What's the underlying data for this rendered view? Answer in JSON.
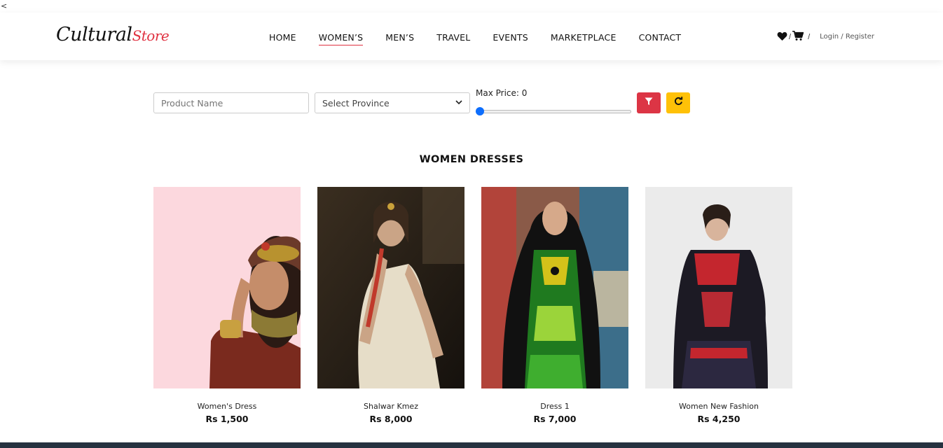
{
  "stray": "<",
  "brand": {
    "name_main": "Cultural",
    "name_accent": "Store",
    "accent_color": "#e03140"
  },
  "nav": {
    "items": [
      {
        "label": "HOME",
        "active": false
      },
      {
        "label": "WOMEN’S",
        "active": true
      },
      {
        "label": "MEN’S",
        "active": false
      },
      {
        "label": "TRAVEL",
        "active": false
      },
      {
        "label": "EVENTS",
        "active": false
      },
      {
        "label": "MARKETPLACE",
        "active": false
      },
      {
        "label": "CONTACT",
        "active": false
      }
    ],
    "right": {
      "wishlist_icon": "heart-icon",
      "cart_icon": "cart-icon",
      "separator": "/",
      "auth_label": "Login / Register"
    }
  },
  "filters": {
    "product_name_placeholder": "Product Name",
    "province_selected": "Select Province",
    "max_price_label": "Max Price: 0",
    "max_price_fraction": 0,
    "filter_button_color": "#dc3545",
    "reset_button_color": "#ffc107"
  },
  "section": {
    "title": "WOMEN DRESSES"
  },
  "products": [
    {
      "name": "Women's Dress",
      "price": "Rs 1,500"
    },
    {
      "name": "Shalwar Kmez",
      "price": "Rs 8,000"
    },
    {
      "name": "Dress 1",
      "price": "Rs 7,000"
    },
    {
      "name": "Women New Fashion",
      "price": "Rs 4,250"
    }
  ]
}
